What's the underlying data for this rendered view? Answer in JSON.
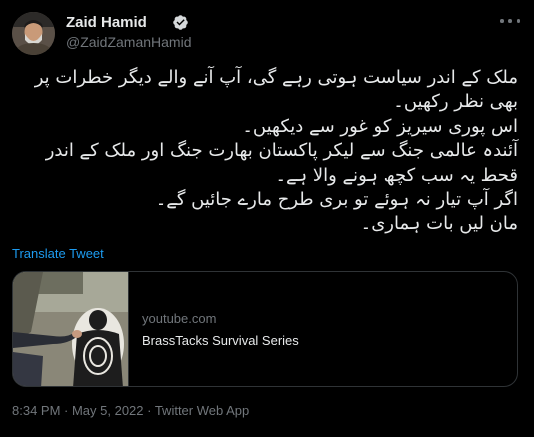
{
  "author": {
    "name": "Zaid Hamid",
    "handle": "@ZaidZamanHamid",
    "verified": true,
    "avatar_icon": "profile-photo"
  },
  "more_icon": "ellipsis-icon",
  "tweet": {
    "text": "ملک کے اندر سیاست ہوتی رہے گی، آپ آنے والے دیگر خطرات پر بھی نظر رکھیں۔\nاس پوری سیریز کو غور سے دیکھیں۔\nآئندہ عالمی جنگ سے لیکر پاکستان بھارت جنگ اور ملک کے اندر قحط یہ سب کچھ ہونے والا ہے۔\nاگر آپ تیار نہ ہوئے تو بری طرح مارے جائیں گے۔\nمان لیں بات ہماری۔",
    "translate_label": "Translate Tweet"
  },
  "card": {
    "domain": "youtube.com",
    "title": "BrassTacks Survival Series"
  },
  "meta": {
    "timestamp": "8:34 PM · May 5, 2022 · Twitter Web App"
  },
  "colors": {
    "background": "#000000",
    "text": "#e7e9ea",
    "muted": "#71767b",
    "link": "#1d9bf0",
    "border": "#2f3336"
  }
}
